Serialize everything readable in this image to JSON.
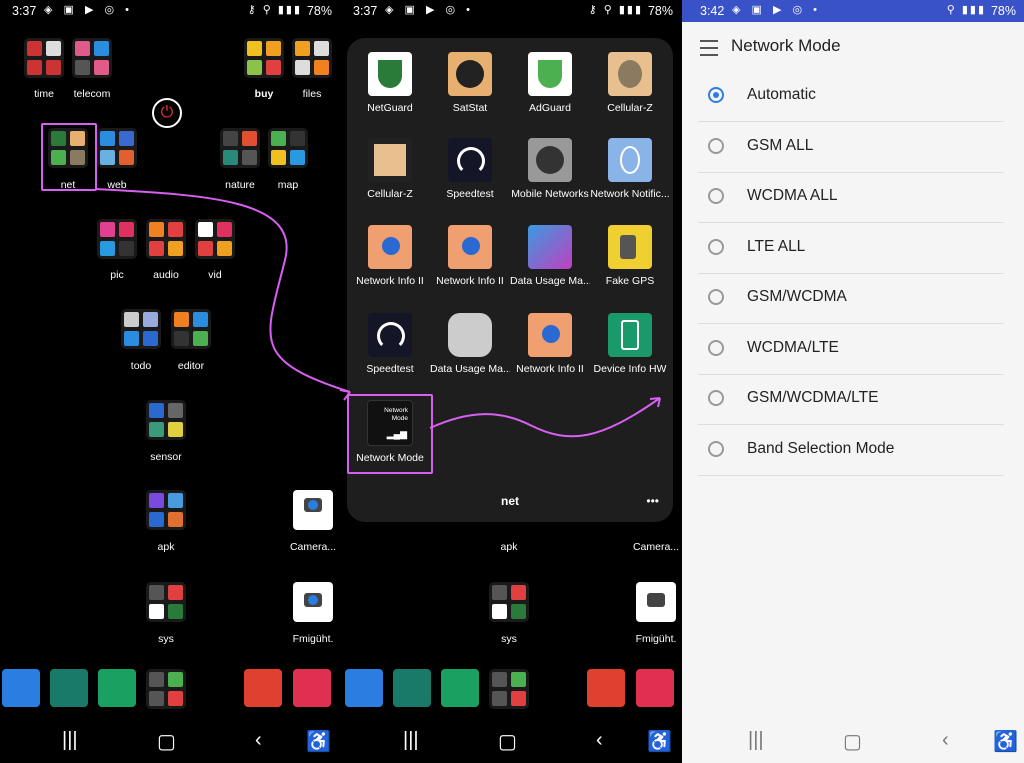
{
  "status": {
    "left_time": "3:37",
    "right_time": "3:42",
    "battery": "78%"
  },
  "home": {
    "labels": {
      "time": "time",
      "telecom": "telecom",
      "buy": "buy",
      "files": "files",
      "net": "net",
      "web": "web",
      "nature": "nature",
      "map": "map",
      "pic": "pic",
      "audio": "audio",
      "vid": "vid",
      "todo": "todo",
      "editor": "editor",
      "sensor": "sensor",
      "apk": "apk",
      "camera": "Camera...",
      "sys": "sys",
      "overlap": "Fmigüht."
    }
  },
  "folder": {
    "title": "net",
    "more": "•••",
    "apps": [
      "NetGuard",
      "SatStat",
      "AdGuard",
      "Cellular-Z",
      "Cellular-Z",
      "Speedtest",
      "Mobile Networks",
      "Network Notific...",
      "Network Info II",
      "Network Info II",
      "Data Usage Ma...",
      "Fake GPS",
      "Speedtest",
      "Data Usage Ma...",
      "Network Info II",
      "Device Info HW",
      "Network Mode"
    ],
    "network_mode_icon_text": "Network Mode"
  },
  "settings": {
    "title": "Network Mode",
    "selected": "Automatic",
    "options": [
      "Automatic",
      "GSM ALL",
      "WCDMA ALL",
      "LTE ALL",
      "GSM/WCDMA",
      "WCDMA/LTE",
      "GSM/WCDMA/LTE",
      "Band Selection Mode"
    ]
  },
  "colors": {
    "accent": "#2f7de1",
    "highlight": "#d860f0",
    "status_bar_blue": "#3a52c8"
  }
}
